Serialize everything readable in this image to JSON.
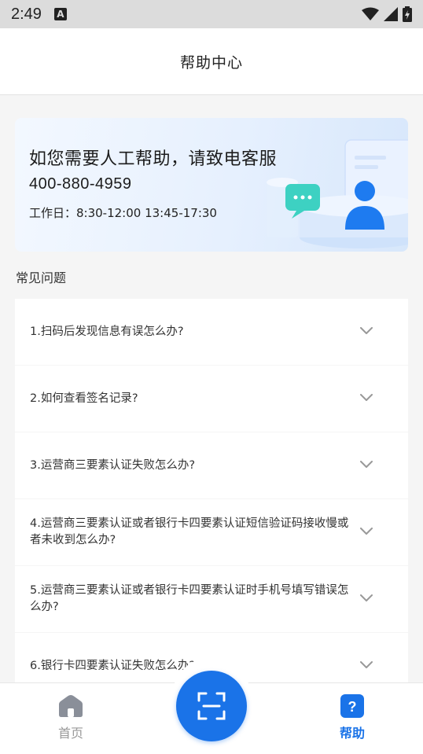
{
  "status_bar": {
    "time": "2:49",
    "notification_letter": "A"
  },
  "header": {
    "title": "帮助中心"
  },
  "banner": {
    "heading": "如您需要人工帮助，请致电客服",
    "phone": "400-880-4959",
    "hours": "工作日：8:30-12:00   13:45-17:30"
  },
  "faq": {
    "title": "常见问题",
    "items": [
      {
        "question": "1.扫码后发现信息有误怎么办?"
      },
      {
        "question": "2.如何查看签名记录?"
      },
      {
        "question": "3.运营商三要素认证失败怎么办?"
      },
      {
        "question": "4.运营商三要素认证或者银行卡四要素认证短信验证码接收慢或者未收到怎么办?"
      },
      {
        "question": "5.运营商三要素认证或者银行卡四要素认证时手机号填写错误怎么办?"
      },
      {
        "question": "6.银行卡四要素认证失败怎么办?"
      }
    ]
  },
  "bottom_nav": {
    "home_label": "首页",
    "help_label": "帮助",
    "accent_color": "#1a73e8",
    "inactive_color": "#999999"
  }
}
